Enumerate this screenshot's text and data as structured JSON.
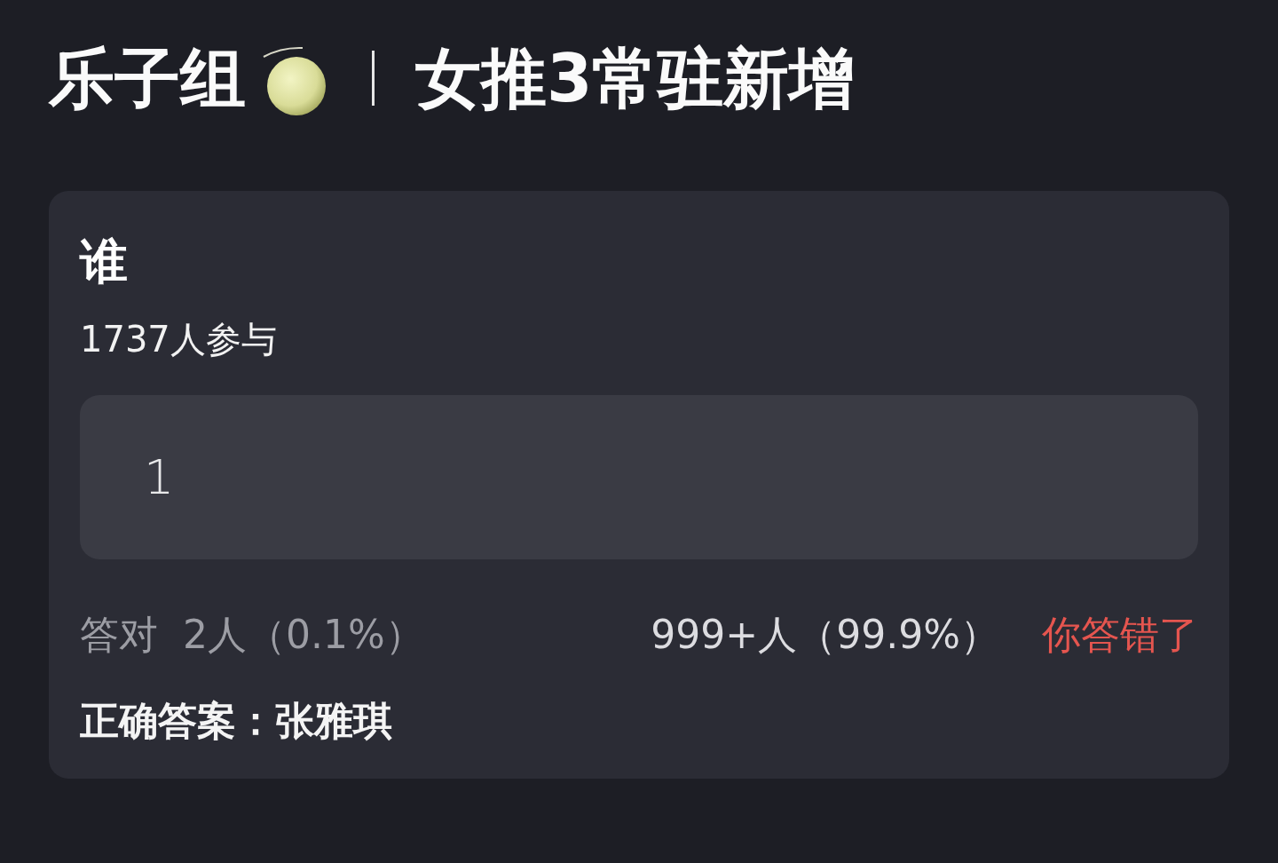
{
  "header": {
    "group": "乐子组",
    "subtitle": "女推3常驻新增"
  },
  "quiz": {
    "question": "谁",
    "participants": "1737人参与",
    "answer": {
      "value": "1"
    },
    "correct_stat": {
      "label": "答对",
      "count": "2人（0.1%）"
    },
    "wrong_stat": "999+人（99.9%）",
    "result": {
      "text": "你答错了",
      "correct": false
    },
    "correct_answer": "正确答案：张雅琪"
  }
}
